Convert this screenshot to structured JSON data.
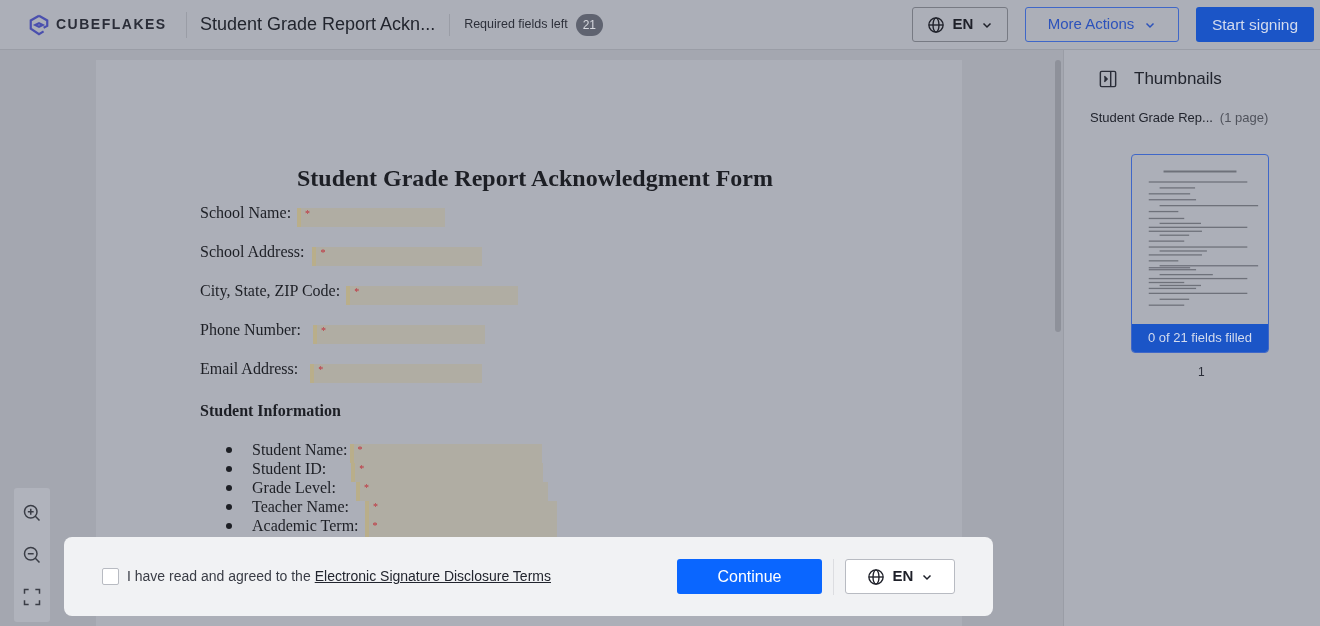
{
  "header": {
    "brand": "CUBEFLAKES",
    "document_title": "Student Grade Report Ackn...",
    "required_label": "Required fields left",
    "required_count": "21",
    "language": "EN",
    "more_actions": "More Actions",
    "start_signing": "Start signing"
  },
  "document": {
    "title": "Student Grade Report Acknowledgment Form",
    "fields": [
      {
        "label": "School Name:",
        "mark": "*"
      },
      {
        "label": "School Address:",
        "mark": "*"
      },
      {
        "label": "City, State, ZIP Code:",
        "mark": "*"
      },
      {
        "label": "Phone Number:",
        "mark": "*"
      },
      {
        "label": "Email Address:",
        "mark": "*"
      }
    ],
    "section": "Student Information",
    "bullets": [
      {
        "label": "Student Name:",
        "mark": "*"
      },
      {
        "label": "Student ID:",
        "mark": "*"
      },
      {
        "label": "Grade Level:",
        "mark": "*"
      },
      {
        "label": "Teacher Name:",
        "mark": "*"
      },
      {
        "label": "Academic Term:",
        "mark": "*"
      }
    ]
  },
  "thumbnails": {
    "title": "Thumbnails",
    "selected": true,
    "doc_name": "Student Grade Rep...",
    "pages": "(1 page)",
    "progress": "0 of 21 fields filled",
    "page_number": "1"
  },
  "consent": {
    "text": "I have read and agreed to the",
    "link": "Electronic Signature Disclosure Terms",
    "checked": false,
    "continue": "Continue",
    "language": "EN"
  }
}
